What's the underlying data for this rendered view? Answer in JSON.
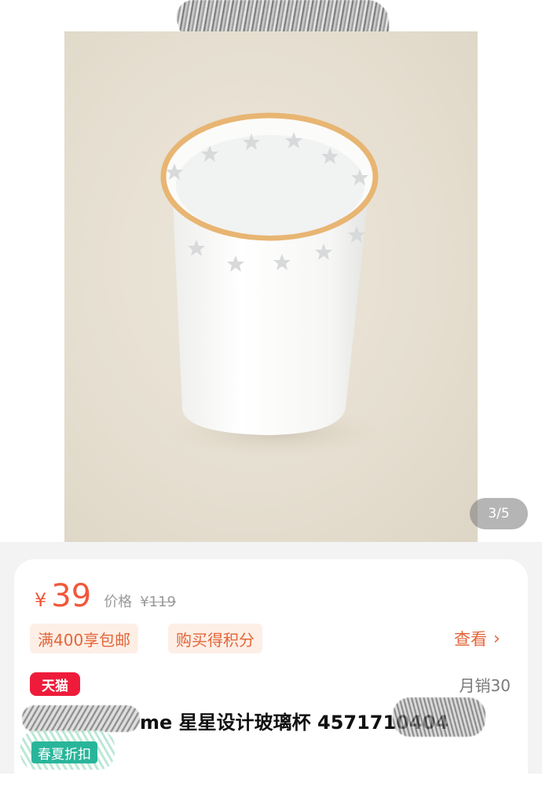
{
  "gallery": {
    "counter": "3/5",
    "image_alt": "白色星星设计杯子产品图"
  },
  "price": {
    "currency": "¥",
    "current": "39",
    "original_label": "价格",
    "original_currency": "¥",
    "original_value": "119"
  },
  "promotions": [
    {
      "label": "满400享包邮"
    },
    {
      "label": "购买得积分"
    }
  ],
  "view_more": {
    "label": "查看",
    "icon": "chevron-right-icon"
  },
  "badge": {
    "label": "天猫",
    "color": "#ee1c3a"
  },
  "sales": {
    "label": "月销30"
  },
  "product": {
    "title": "me 星星设计玻璃杯 4571710404"
  },
  "tag": {
    "label": "春夏折扣",
    "color": "#29b59a"
  },
  "colors": {
    "accent": "#f0583a",
    "promo_bg": "#fdefe6",
    "promo_text": "#e4653a"
  }
}
